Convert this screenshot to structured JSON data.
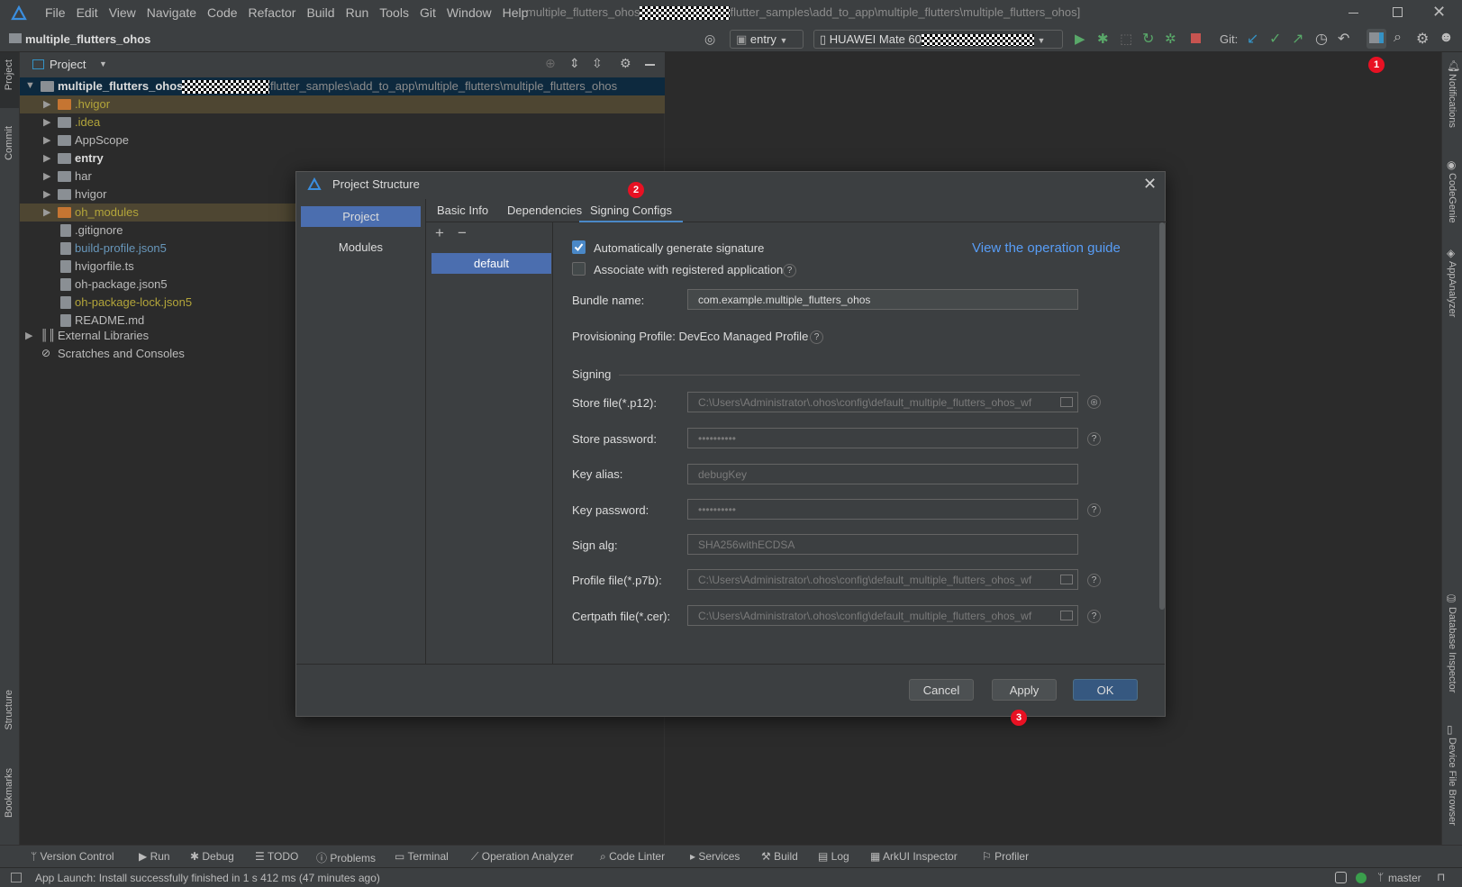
{
  "titlebar": {
    "menus": [
      "File",
      "Edit",
      "View",
      "Navigate",
      "Code",
      "Refactor",
      "Build",
      "Run",
      "Tools",
      "Git",
      "Window",
      "Help"
    ],
    "title_prefix": "multiple_flutters_ohos",
    "title_suffix": "flutter_samples\\add_to_app\\multiple_flutters\\multiple_flutters_ohos]"
  },
  "toolbar": {
    "project_name": "multiple_flutters_ohos",
    "run_config": "entry",
    "device_prefix": "HUAWEI Mate 60",
    "git_label": "Git:"
  },
  "left_stripe": {
    "project": "Project",
    "commit": "Commit",
    "structure": "Structure",
    "bookmarks": "Bookmarks"
  },
  "right_stripe": {
    "notifications": "Notifications",
    "codegenie": "CodeGenie",
    "appanalyzer": "AppAnalyzer",
    "database": "Database Inspector",
    "device": "Device File Browser"
  },
  "project_panel": {
    "header": "Project",
    "root_name": "multiple_flutters_ohos",
    "root_path": "flutter_samples\\add_to_app\\multiple_flutters\\multiple_flutters_ohos",
    "items": [
      {
        "label": ".hvigor",
        "kind": "folder",
        "color": "#b3a53a"
      },
      {
        "label": ".idea",
        "kind": "folder",
        "color": "#b3a53a"
      },
      {
        "label": "AppScope",
        "kind": "folder",
        "color": "#bbbbbb"
      },
      {
        "label": "entry",
        "kind": "folder",
        "color": "#dcdcdc"
      },
      {
        "label": "har",
        "kind": "folder",
        "color": "#bbbbbb"
      },
      {
        "label": "hvigor",
        "kind": "folder",
        "color": "#bbbbbb"
      },
      {
        "label": "oh_modules",
        "kind": "folder",
        "color": "#b3a53a"
      },
      {
        "label": ".gitignore",
        "kind": "file",
        "color": "#bbbbbb"
      },
      {
        "label": "build-profile.json5",
        "kind": "file",
        "color": "#6897bb"
      },
      {
        "label": "hvigorfile.ts",
        "kind": "file",
        "color": "#bbbbbb"
      },
      {
        "label": "oh-package.json5",
        "kind": "file",
        "color": "#bbbbbb"
      },
      {
        "label": "oh-package-lock.json5",
        "kind": "file",
        "color": "#b3a53a"
      },
      {
        "label": "README.md",
        "kind": "file",
        "color": "#bbbbbb"
      }
    ],
    "external": "External Libraries",
    "scratches": "Scratches and Consoles"
  },
  "dialog": {
    "title": "Project Structure",
    "nav": [
      "Project",
      "Modules"
    ],
    "tabs": [
      "Basic Info",
      "Dependencies",
      "Signing Configs"
    ],
    "config_item": "default",
    "auto_sign": "Automatically generate signature",
    "associate": "Associate with registered application",
    "guide_link": "View the operation guide",
    "bundle_label": "Bundle name:",
    "bundle_value": "com.example.multiple_flutters_ohos",
    "provisioning": "Provisioning Profile: DevEco Managed Profile",
    "signing_header": "Signing",
    "store_file_label": "Store file(*.p12):",
    "store_file_value": "C:\\Users\\Administrator\\.ohos\\config\\default_multiple_flutters_ohos_wf",
    "store_pwd_label": "Store password:",
    "store_pwd_value": "••••••••••",
    "key_alias_label": "Key alias:",
    "key_alias_value": "debugKey",
    "key_pwd_label": "Key password:",
    "key_pwd_value": "••••••••••",
    "sign_alg_label": "Sign alg:",
    "sign_alg_value": "SHA256withECDSA",
    "profile_label": "Profile file(*.p7b):",
    "profile_value": "C:\\Users\\Administrator\\.ohos\\config\\default_multiple_flutters_ohos_wf",
    "certpath_label": "Certpath file(*.cer):",
    "certpath_value": "C:\\Users\\Administrator\\.ohos\\config\\default_multiple_flutters_ohos_wf",
    "cancel": "Cancel",
    "apply": "Apply",
    "ok": "OK"
  },
  "badges": [
    "1",
    "2",
    "3"
  ],
  "bottom_tools": [
    "Version Control",
    "Run",
    "Debug",
    "TODO",
    "Problems",
    "Terminal",
    "Operation Analyzer",
    "Code Linter",
    "Services",
    "Build",
    "Log",
    "ArkUI Inspector",
    "Profiler"
  ],
  "status": {
    "message": "App Launch: Install successfully finished in 1 s 412 ms (47 minutes ago)",
    "branch": "master"
  },
  "colors": {
    "accent": "#4a88c7",
    "badge": "#e81123",
    "selection": "#4b6eaf"
  }
}
